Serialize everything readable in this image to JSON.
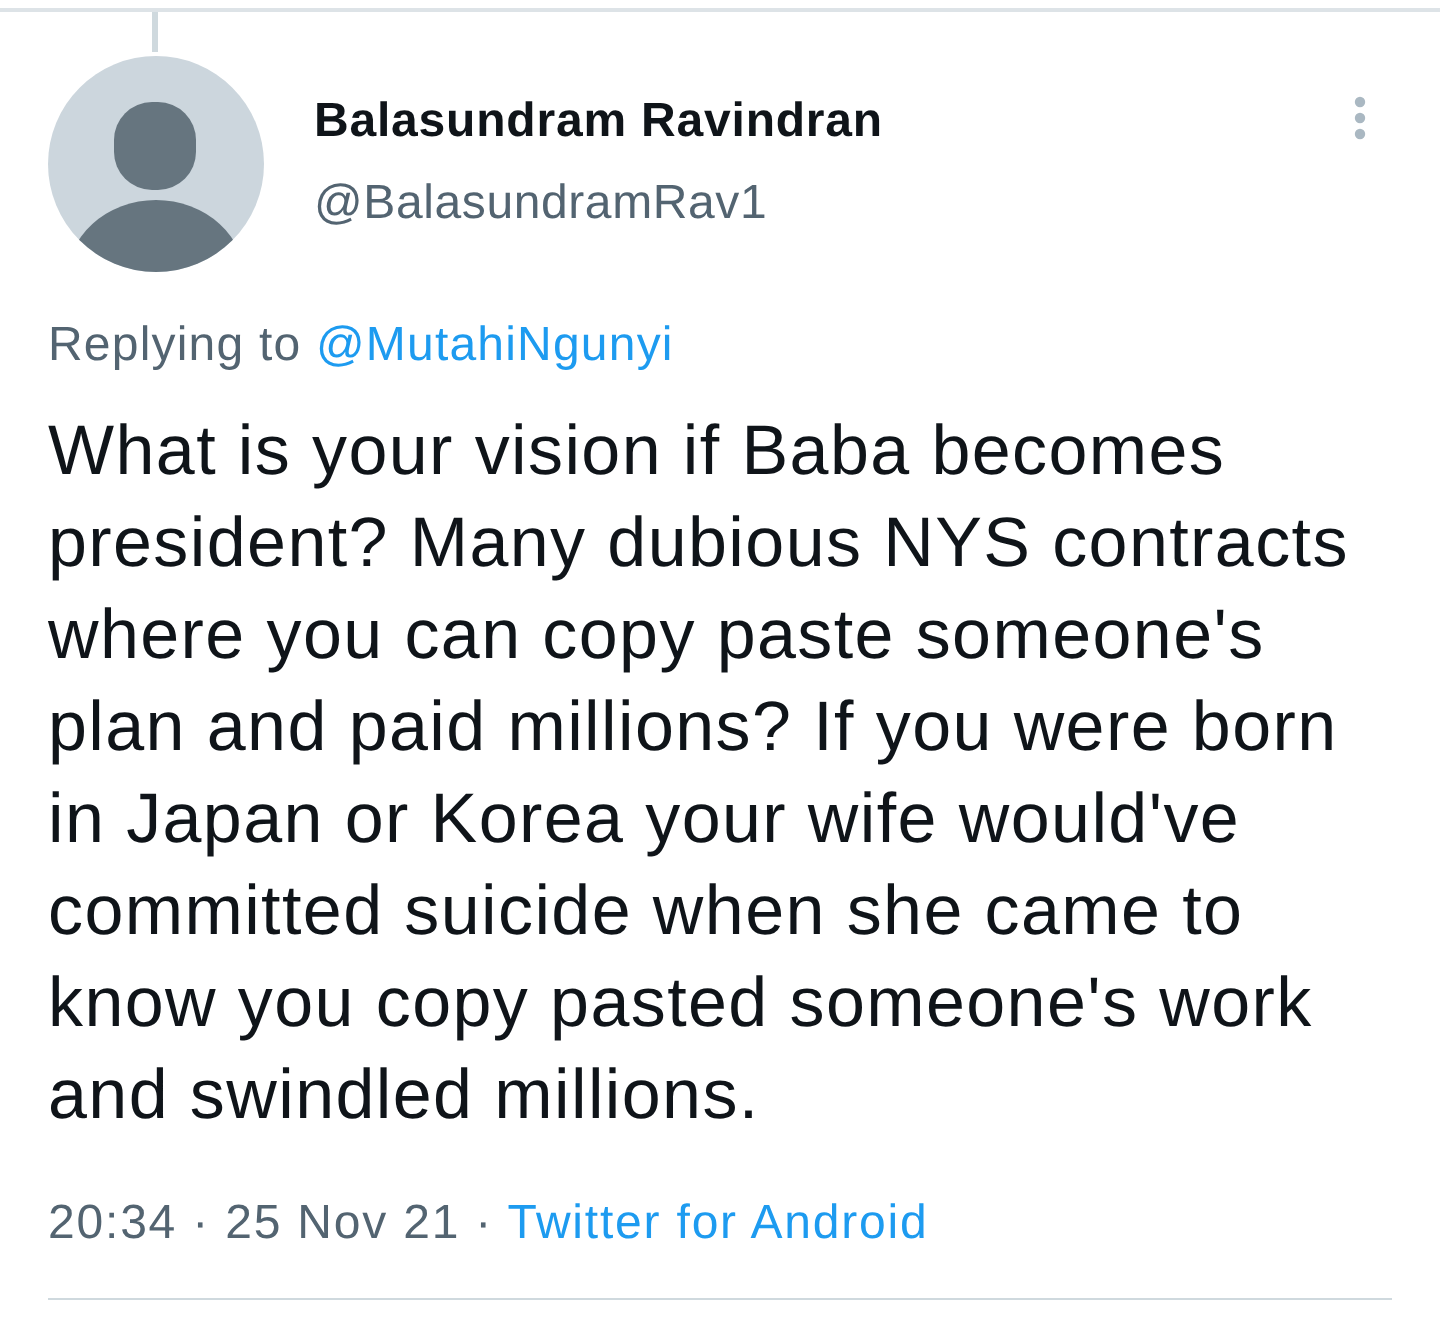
{
  "author": {
    "name": "Balasundram Ravindran",
    "handle": "@BalasundramRav1"
  },
  "reply": {
    "label": "Replying to",
    "mention": "@MutahiNgunyi"
  },
  "text": "What is your vision if Baba becomes president? Many dubious NYS contracts where you can copy paste someone's plan and paid millions? If you were born in Japan or Korea your wife would've committed suicide when she came to know you copy pasted someone's work and swindled millions.",
  "meta": {
    "timestamp": "20:34 · 25 Nov 21 ·",
    "source": "Twitter for Android"
  }
}
